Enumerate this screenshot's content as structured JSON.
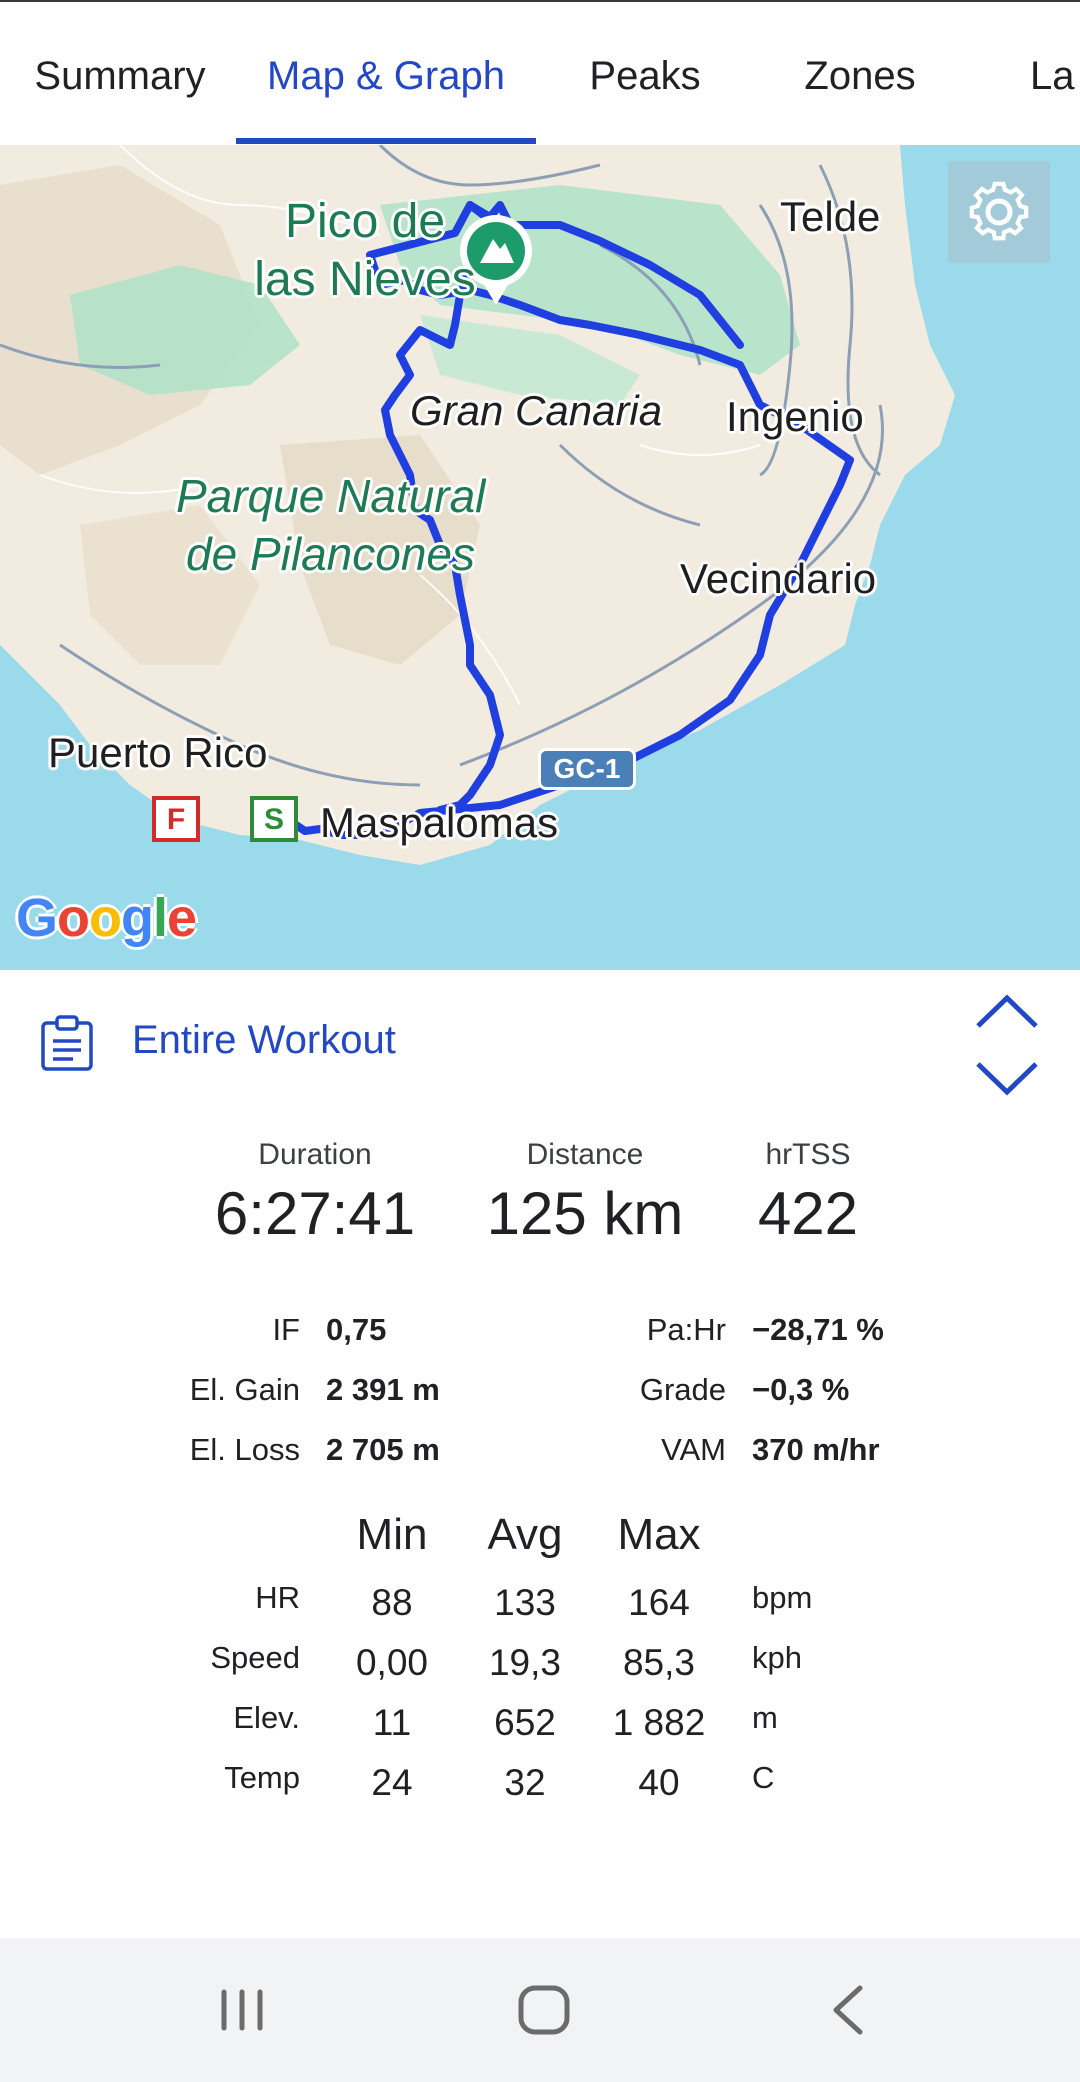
{
  "tabs": [
    {
      "label": "Summary"
    },
    {
      "label": "Map & Graph"
    },
    {
      "label": "Peaks"
    },
    {
      "label": "Zones"
    },
    {
      "label": "La"
    }
  ],
  "map": {
    "peak_label_line1": "Pico de",
    "peak_label_line2": "las Nieves",
    "island_label": "Gran Canaria",
    "park_label_line1": "Parque Natural",
    "park_label_line2": "de Pilancones",
    "towns": {
      "telde": "Telde",
      "ingenio": "Ingenio",
      "vecindario": "Vecindario",
      "puerto_rico": "Puerto Rico",
      "maspalomas": "Maspalomas"
    },
    "road_badge": "GC-1",
    "finish_flag": "F",
    "start_flag": "S",
    "attribution": "Google",
    "route_color": "#1f3fe0"
  },
  "workout": {
    "title": "Entire Workout"
  },
  "summary": {
    "duration_label": "Duration",
    "duration_value": "6:27:41",
    "distance_label": "Distance",
    "distance_value": "125 km",
    "tss_label": "hrTSS",
    "tss_value": "422"
  },
  "details": {
    "left": [
      {
        "label": "IF",
        "value": "0,75"
      },
      {
        "label": "El. Gain",
        "value": "2 391 m"
      },
      {
        "label": "El. Loss",
        "value": "2 705 m"
      }
    ],
    "right": [
      {
        "label": "Pa:Hr",
        "value": "−28,71 %"
      },
      {
        "label": "Grade",
        "value": "−0,3 %"
      },
      {
        "label": "VAM",
        "value": "370 m/hr"
      }
    ]
  },
  "minmax": {
    "headers": {
      "min": "Min",
      "avg": "Avg",
      "max": "Max"
    },
    "rows": [
      {
        "label": "HR",
        "min": "88",
        "avg": "133",
        "max": "164",
        "unit": "bpm"
      },
      {
        "label": "Speed",
        "min": "0,00",
        "avg": "19,3",
        "max": "85,3",
        "unit": "kph"
      },
      {
        "label": "Elev.",
        "min": "11",
        "avg": "652",
        "max": "1 882",
        "unit": "m"
      },
      {
        "label": "Temp",
        "min": "24",
        "avg": "32",
        "max": "40",
        "unit": "C"
      }
    ]
  },
  "colors": {
    "accent": "#2348c5",
    "sea": "#9adaea",
    "land": "#f2ece0",
    "forest": "#aee3c8"
  }
}
